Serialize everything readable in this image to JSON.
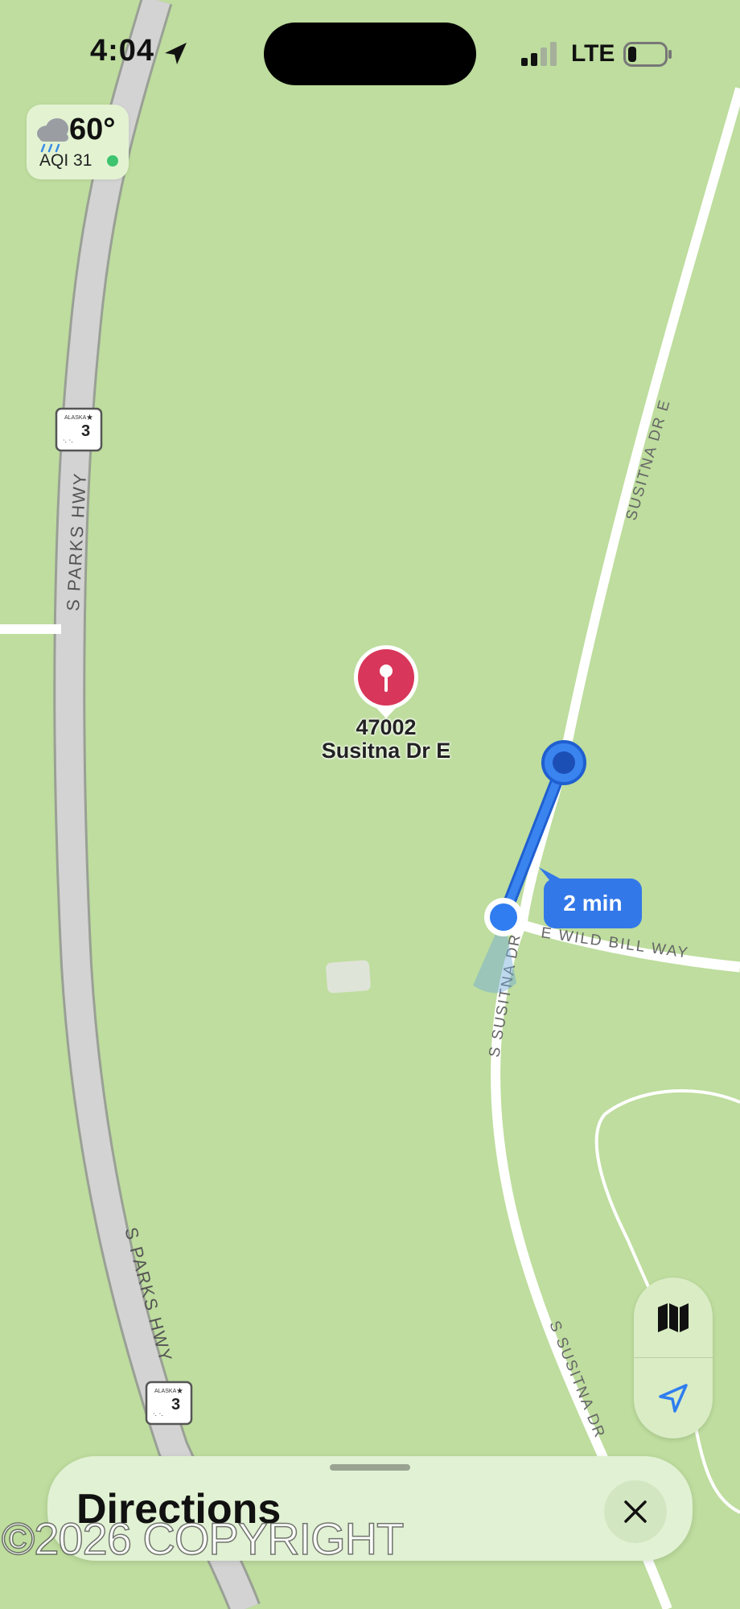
{
  "status_bar": {
    "time": "4:04",
    "network": "LTE",
    "location_icon": "location-arrow-icon",
    "signal_icon": "cellular-signal-icon",
    "battery_icon": "battery-low-icon"
  },
  "weather": {
    "icon": "rain-cloud-icon",
    "temperature": "60°",
    "aqi": "AQI 31",
    "aqi_color": "#3dc46f"
  },
  "map": {
    "roads": [
      {
        "name": "S PARKS HWY"
      },
      {
        "name": "S PARKS HWY"
      },
      {
        "name": "SUSITNA DR E"
      },
      {
        "name": "E WILD BILL WAY"
      },
      {
        "name": "S SUSITNA DR"
      },
      {
        "name": "S SUSITNA DR"
      }
    ],
    "highway_shields": [
      {
        "state": "ALASKA",
        "number": "3"
      },
      {
        "state": "ALASKA",
        "number": "3"
      }
    ],
    "pin": {
      "icon": "map-pin-icon",
      "line1": "47002",
      "line2": "Susitna Dr E",
      "color": "#d8365a"
    },
    "route": {
      "duration": "2 min",
      "color": "#3378e8"
    }
  },
  "map_controls": {
    "map_mode_icon": "map-icon",
    "locate_icon": "location-arrow-icon"
  },
  "sheet": {
    "title": "Directions",
    "close_icon": "close-icon"
  },
  "watermark": "©2026 COPYRIGHT"
}
